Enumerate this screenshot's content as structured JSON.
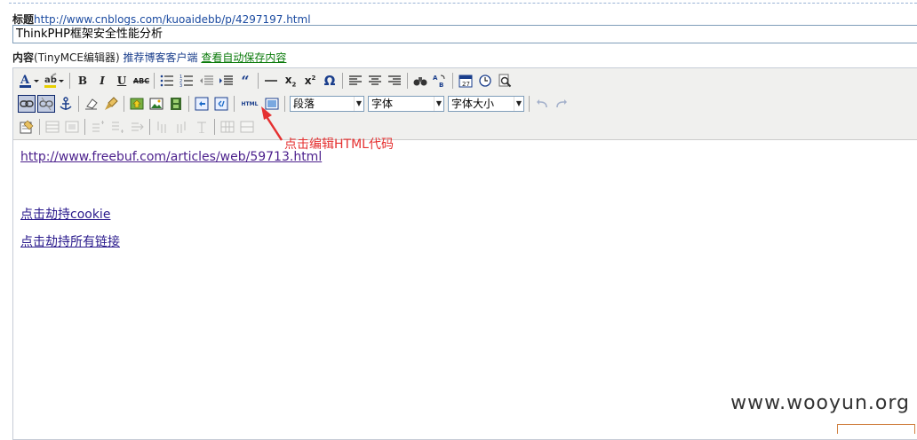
{
  "title_label": "标题",
  "title_url": "http://www.cnblogs.com/kuoaidebb/p/4297197.html",
  "title_value": "ThinkPHP框架安全性能分析",
  "content_label": "内容",
  "content_editor_name": "(TinyMCE编辑器)",
  "recommend_client": "推荐博客客户端",
  "view_autosave": "查看自动保存内容",
  "toolbar": {
    "format_select": "段落",
    "font_select": "字体",
    "size_select": "字体大小",
    "html_label": "HTML"
  },
  "editor_content": {
    "link1": "http://www.freebuf.com/articles/web/59713.html",
    "link2": "点击劫持cookie",
    "link3": "点击劫持所有链接"
  },
  "annotation": "点击编辑HTML代码",
  "watermark": "www.wooyun.org",
  "colors": {
    "toolbar_bg": "#f0f0ee",
    "active_button_bg": "#c2cbe0",
    "annotation": "#e53030",
    "link": "#2a1a8c"
  }
}
